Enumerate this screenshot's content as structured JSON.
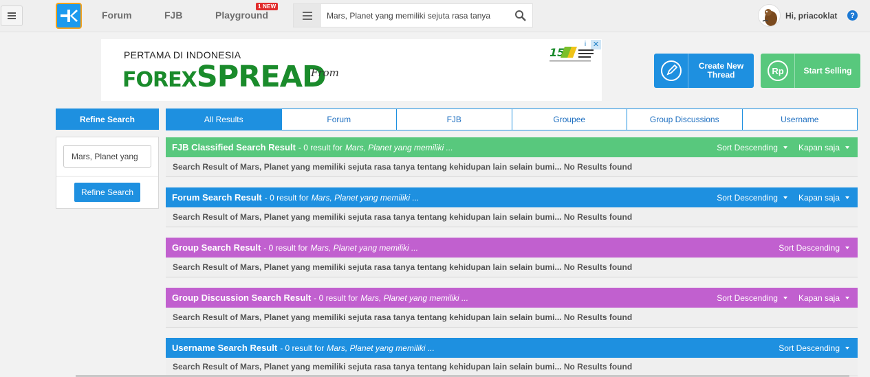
{
  "header": {
    "nav": [
      {
        "label": "Forum"
      },
      {
        "label": "FJB"
      },
      {
        "label": "Playground",
        "badge": "1 NEW"
      }
    ],
    "search": {
      "value": "Mars, Planet yang memiliki sejuta rasa tanya"
    },
    "user": {
      "greeting": "Hi, priacoklat"
    },
    "help_label": "?"
  },
  "ad": {
    "line1": "PERTAMA DI INDONESIA",
    "forex_small": "FOREX",
    "forex_big": "SPREAD",
    "from": "From",
    "info_icon": "i",
    "close_icon": "✕",
    "sponsor_tag": "15"
  },
  "actions": {
    "create": {
      "label": "Create New Thread"
    },
    "sell": {
      "label": "Start Selling",
      "icon_text": "Rp"
    }
  },
  "sidebar": {
    "header": "Refine Search",
    "input_value": "Mars, Planet yang",
    "button": "Refine Search"
  },
  "tabs": [
    {
      "label": "All Results",
      "active": true
    },
    {
      "label": "Forum"
    },
    {
      "label": "FJB"
    },
    {
      "label": "Groupee"
    },
    {
      "label": "Group Discussions"
    },
    {
      "label": "Username"
    }
  ],
  "results": [
    {
      "title": "FJB Classified Search Result",
      "count": "- 0 result for",
      "query": "Mars, Planet yang memiliki ...",
      "sort": "Sort Descending",
      "time": "Kapan saja",
      "body": "Search Result of Mars, Planet yang memiliki sejuta rasa tanya tentang kehidupan lain selain bumi... No Results found"
    },
    {
      "title": "Forum Search Result",
      "count": "- 0 result for",
      "query": "Mars, Planet yang memiliki ...",
      "sort": "Sort Descending",
      "time": "Kapan saja",
      "body": "Search Result of Mars, Planet yang memiliki sejuta rasa tanya tentang kehidupan lain selain bumi... No Results found"
    },
    {
      "title": "Group Search Result",
      "count": "- 0 result for",
      "query": "Mars, Planet yang memiliki ...",
      "sort": "Sort Descending",
      "body": "Search Result of Mars, Planet yang memiliki sejuta rasa tanya tentang kehidupan lain selain bumi... No Results found"
    },
    {
      "title": "Group Discussion Search Result",
      "count": "- 0 result for",
      "query": "Mars, Planet yang memiliki ...",
      "sort": "Sort Descending",
      "time": "Kapan saja",
      "body": "Search Result of Mars, Planet yang memiliki sejuta rasa tanya tentang kehidupan lain selain bumi... No Results found"
    },
    {
      "title": "Username Search Result",
      "count": "- 0 result for",
      "query": "Mars, Planet yang memiliki ...",
      "sort": "Sort Descending",
      "body": "Search Result of Mars, Planet yang memiliki sejuta rasa tanya tentang kehidupan lain selain bumi... No Results found"
    }
  ],
  "colors": {
    "blue": "#1e90e0",
    "green": "#58c87d",
    "purple": "#c160cf",
    "logo_border": "#f7a21b",
    "badge_red": "#e12b2b"
  }
}
